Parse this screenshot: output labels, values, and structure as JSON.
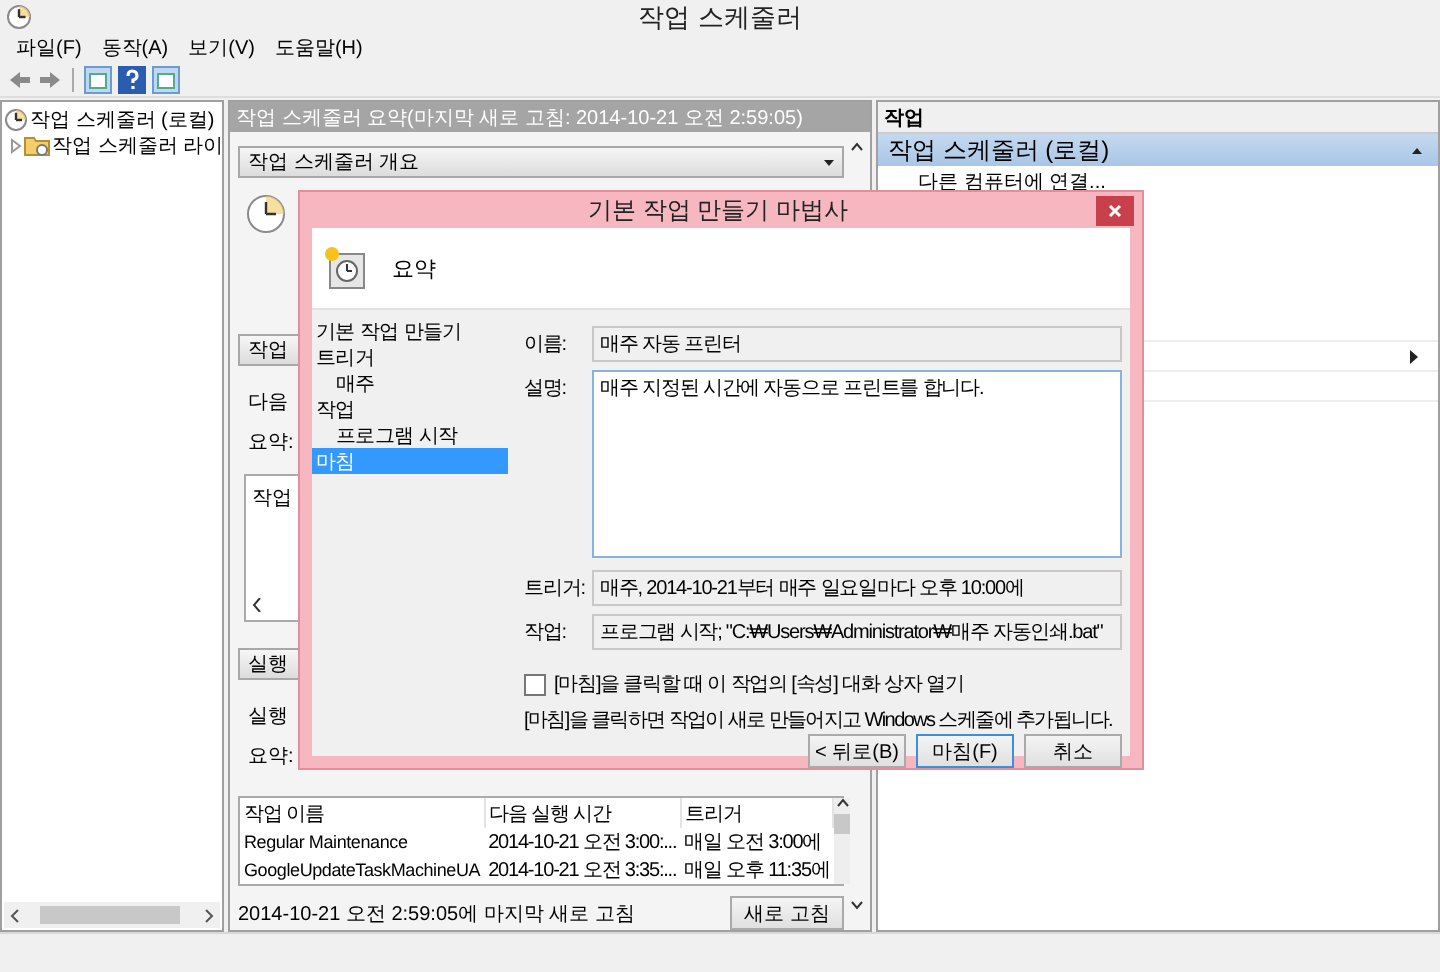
{
  "window": {
    "title": "작업 스케줄러"
  },
  "menu": [
    "파일(F)",
    "동작(A)",
    "보기(V)",
    "도움말(H)"
  ],
  "tree": [
    {
      "label": "작업 스케줄러 (로컬)",
      "children": [
        {
          "label": "작업 스케줄러 라이",
          "expanded": false
        }
      ]
    }
  ],
  "summary": {
    "header": "작업 스케줄러 요약(마지막 새로 고침: 2014-10-21 오전 2:59:05)",
    "overview_title": "작업 스케줄러 개요",
    "status_title": "작업",
    "status_labels": [
      "다음",
      "요약:"
    ],
    "status_list_header": "작업",
    "running_title": "실행",
    "running_labels": [
      "실행",
      "요약:"
    ],
    "table": {
      "columns": [
        "작업 이름",
        "다음 실행 시간",
        "트리거"
      ],
      "rows": [
        [
          "Regular Maintenance",
          "2014-10-21 오전 3:00:...",
          "매일 오전 3:00에"
        ],
        [
          "GoogleUpdateTaskMachineUA",
          "2014-10-21 오전 3:35:...",
          "매일 오후 11:35에"
        ]
      ]
    },
    "refreshed": "2014-10-21 오전 2:59:05에 마지막 새로 고침",
    "refresh_button": "새로 고침"
  },
  "actions": {
    "title": "작업",
    "group": "작업 스케줄러 (로컬)",
    "items": [
      "다른 컴퓨터에 연결..."
    ]
  },
  "dialog": {
    "title": "기본 작업 만들기 마법사",
    "heading": "요약",
    "steps": [
      {
        "label": "기본 작업 만들기",
        "selected": false
      },
      {
        "label": "트리거",
        "selected": false,
        "children": [
          {
            "label": "매주",
            "selected": false
          }
        ]
      },
      {
        "label": "작업",
        "selected": false,
        "children": [
          {
            "label": "프로그램 시작",
            "selected": false
          }
        ]
      },
      {
        "label": "마침",
        "selected": true
      }
    ],
    "fields": [
      {
        "label": "이름:",
        "value": "매주 자동 프린터",
        "kind": "line"
      },
      {
        "label": "설명:",
        "value": "매주 지정된 시간에 자동으로 프린트를 합니다.",
        "kind": "area"
      },
      {
        "label": "트리거:",
        "value": "매주, 2014-10-21부터 매주 일요일마다 오후 10:00에",
        "kind": "line"
      },
      {
        "label": "작업:",
        "value": "프로그램 시작; \"C:₩Users₩Administrator₩매주 자동인쇄.bat\"",
        "kind": "line"
      }
    ],
    "checkbox": {
      "label": "[마침]을 클릭할 때 이 작업의 [속성] 대화 상자 열기",
      "checked": false
    },
    "note": "[마침]을 클릭하면 작업이 새로 만들어지고 Windows 스케줄에 추가됩니다.",
    "buttons": [
      {
        "label": "< 뒤로(B)",
        "default": false
      },
      {
        "label": "마침(F)",
        "default": true
      },
      {
        "label": "취소",
        "default": false
      }
    ]
  }
}
